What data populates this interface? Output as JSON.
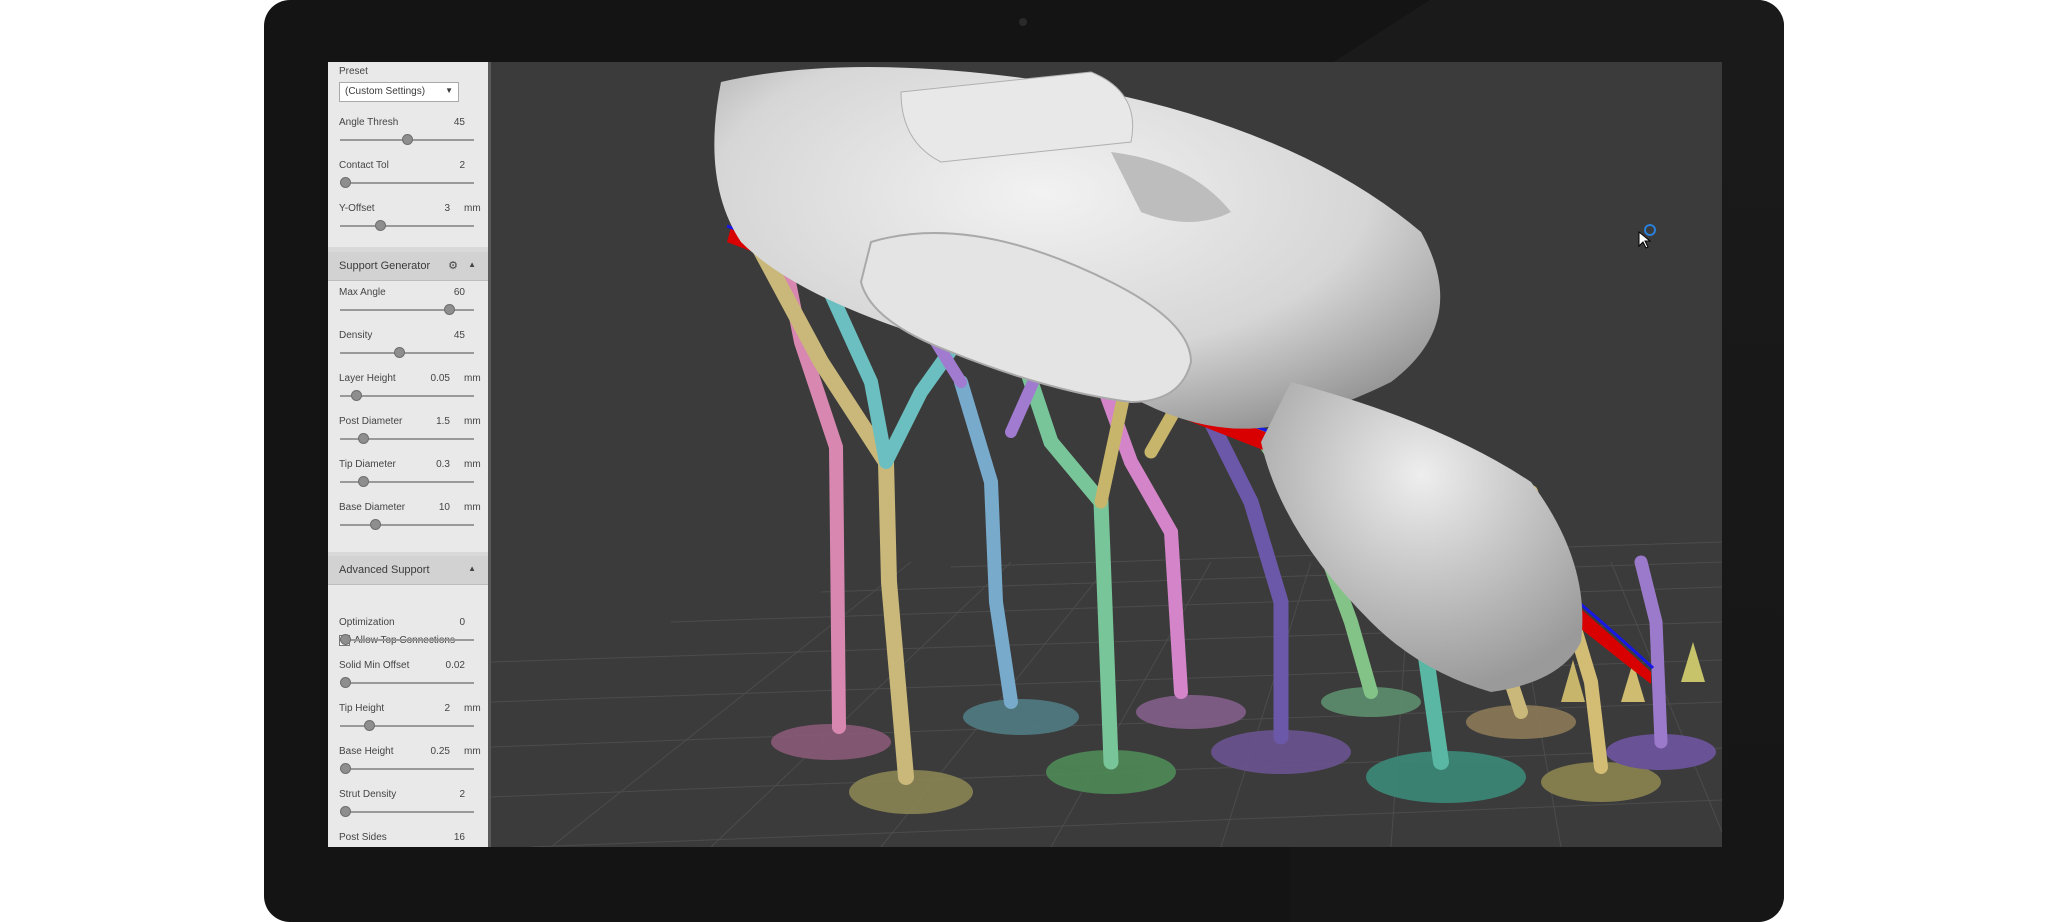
{
  "panel": {
    "preset": {
      "label": "Preset",
      "value": "(Custom Settings)"
    },
    "top_fields": [
      {
        "label": "Angle Thresh",
        "value": "45",
        "unit": "",
        "level": 0.5
      },
      {
        "label": "Contact Tol",
        "value": "2",
        "unit": "",
        "level": 0.04
      },
      {
        "label": "Y-Offset",
        "value": "3",
        "unit": "mm",
        "level": 0.3
      }
    ],
    "support_generator": {
      "title": "Support Generator",
      "fields": [
        {
          "label": "Max Angle",
          "value": "60",
          "unit": "",
          "level": 0.81
        },
        {
          "label": "Density",
          "value": "45",
          "unit": "",
          "level": 0.44
        },
        {
          "label": "Layer Height",
          "value": "0.05",
          "unit": "mm",
          "level": 0.12
        },
        {
          "label": "Post Diameter",
          "value": "1.5",
          "unit": "mm",
          "level": 0.17
        },
        {
          "label": "Tip Diameter",
          "value": "0.3",
          "unit": "mm",
          "level": 0.17
        },
        {
          "label": "Base Diameter",
          "value": "10",
          "unit": "mm",
          "level": 0.26
        }
      ]
    },
    "advanced_support": {
      "title": "Advanced Support",
      "checkbox_label": "Allow Top Connections",
      "checkbox_checked": true,
      "fields": [
        {
          "label": "Optimization",
          "value": "0",
          "unit": "",
          "level": 0.04
        },
        {
          "label": "Solid Min Offset",
          "value": "0.02",
          "unit": "",
          "level": 0.04
        },
        {
          "label": "Tip Height",
          "value": "2",
          "unit": "mm",
          "level": 0.22
        },
        {
          "label": "Base Height",
          "value": "0.25",
          "unit": "mm",
          "level": 0.04
        },
        {
          "label": "Strut Density",
          "value": "2",
          "unit": "",
          "level": 0.04
        },
        {
          "label": "Post Sides",
          "value": "16",
          "unit": "",
          "level": null
        }
      ]
    }
  },
  "colors": {
    "bezel": "#141414",
    "viewport_bg": "#3b3b3b",
    "panel_bg": "#e9e9e9",
    "model": "#d8d8d8",
    "support_overhang": "#e00000",
    "support_outline": "#1010e0"
  },
  "icons": {
    "gear": "gear-icon",
    "collapse": "triangle-up-icon",
    "dropdown": "chevron-down-icon",
    "cursor": "arrow-cursor-icon"
  }
}
